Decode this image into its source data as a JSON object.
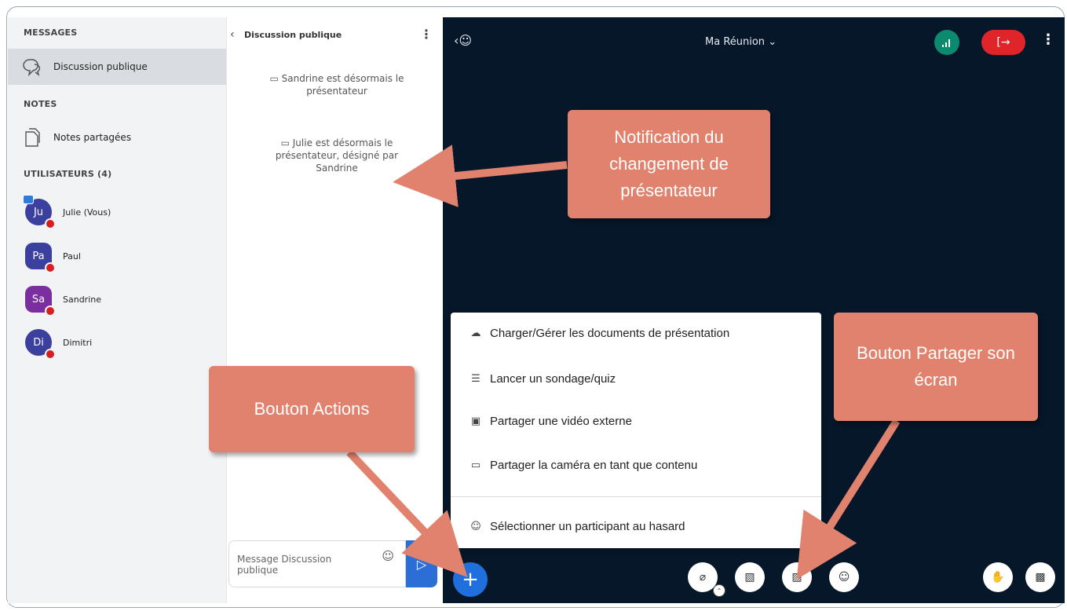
{
  "sidebar": {
    "messages_title": "MESSAGES",
    "public_chat_label": "Discussion publique",
    "notes_title": "NOTES",
    "shared_notes_label": "Notes partagées",
    "users_title": "UTILISATEURS (4)",
    "users": [
      {
        "initials": "Ju",
        "name": "Julie (Vous)",
        "color": "#3b3f9e"
      },
      {
        "initials": "Pa",
        "name": "Paul",
        "color": "#3b3f9e"
      },
      {
        "initials": "Sa",
        "name": "Sandrine",
        "color": "#7a2ea0"
      },
      {
        "initials": "Di",
        "name": "Dimitri",
        "color": "#3b3f9e"
      }
    ]
  },
  "chat": {
    "title": "Discussion publique",
    "messages": [
      "Sandrine est désormais le présentateur",
      "Julie est désormais le présentateur, désigné par Sandrine"
    ],
    "input_placeholder": "Message Discussion publique"
  },
  "main": {
    "meeting_title": "Ma Réunion",
    "conn_icon": "signal-icon",
    "leave_icon": "logout-icon"
  },
  "actions_menu": {
    "items": [
      {
        "icon": "upload-cloud-icon",
        "label": "Charger/Gérer les documents de présentation"
      },
      {
        "icon": "poll-list-icon",
        "label": "Lancer un sondage/quiz"
      },
      {
        "icon": "video-external-icon",
        "label": "Partager une vidéo externe"
      },
      {
        "icon": "camera-content-icon",
        "label": "Partager la caméra en tant que contenu"
      },
      {
        "icon": "user-random-icon",
        "label": "Sélectionner un participant au hasard"
      }
    ]
  },
  "callouts": {
    "presenter_change": "Notification du changement de présentateur",
    "actions_button": "Bouton Actions",
    "share_screen": "Bouton Partager son écran"
  },
  "colors": {
    "accent_blue": "#1f6fdc",
    "dark_bg": "#06172a",
    "leave_red": "#e0252a",
    "connection_green": "#0b8a70",
    "callout": "#e0826e"
  }
}
